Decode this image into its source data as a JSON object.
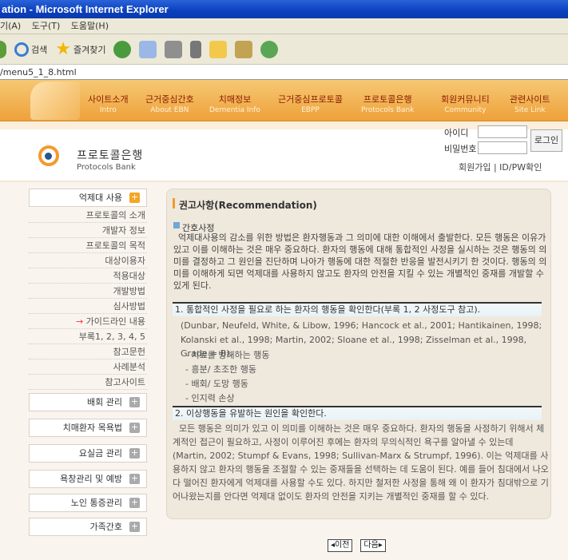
{
  "window": {
    "title": "ation - Microsoft Internet Explorer"
  },
  "menu": [
    "기(A)",
    "도구(T)",
    "도움말(H)"
  ],
  "toolbar": {
    "search": "검색",
    "favorites": "즐겨찾기"
  },
  "address": "/menu5_1_8.html",
  "nav": [
    {
      "ko": "사이트소개",
      "en": "Intro"
    },
    {
      "ko": "근거중심간호",
      "en": "About EBN"
    },
    {
      "ko": "치매정보",
      "en": "Dementia Info"
    },
    {
      "ko": "근거중심프로토콜",
      "en": "EBPP"
    },
    {
      "ko": "프로토콜은행",
      "en": "Protocols Bank"
    },
    {
      "ko": "회원커뮤니티",
      "en": "Community"
    },
    {
      "ko": "관련사이트",
      "en": "Site Link"
    }
  ],
  "site": {
    "title": "프로토콜은행",
    "subtitle": "Protocols Bank"
  },
  "login": {
    "id_label": "아이디",
    "pw_label": "비밀번호",
    "button": "로그인",
    "links": "회원가입 | ID/PW확인"
  },
  "left_menu": {
    "groups": [
      "억제대 사용",
      "배회 관리",
      "치매환자 목욕법",
      "요실금 관리",
      "욕창관리 및 예방",
      "노인 통증관리",
      "가족간호"
    ],
    "sub": [
      "프로토콜의 소개",
      "개발자 정보",
      "프로토콜의 목적",
      "대상이용자",
      "적용대상",
      "개발방법",
      "심사방법",
      "가이드라인 내용",
      "부록1, 2, 3, 4, 5",
      "참고문헌",
      "사례분석",
      "참고사이트"
    ],
    "current_arrow": "→"
  },
  "content": {
    "title": "권고사항(Recommendation)",
    "nurse_head": "간호사정",
    "nurse_text": "억제대사용의 감소를 위한 방법은 환자행동과 그 의미에 대한 이해에서 출발한다. 모든 행동은 이유가 있고 이를 이해하는 것은 매우 중요하다. 환자의 행동에 대해 통합적인 사정을 실시하는 것은 행동의 의미를 결정하고 그 원인을 진단하며 나아가 행동에 대한 적절한 반응을 발전시키기 한 것이다. 행동의 의미를 이해하게 되면 억제대를 사용하지 않고도 환자의 안전을 지킬 수 있는 개별적인 중재를 개발할 수 있게 된다.",
    "step1": "1. 통합적인 사정을 필요로 하는 환자의 행동을 확인한다(부록 1, 2 사정도구 참고).",
    "ref1": "(Dunbar, Neufeld, White, & Libow, 1996; Hancock et al., 2001; Hantikainen, 1998;",
    "ref2": "Kolanski et al., 1998; Martin, 2002; Sloane et al., 1998; Zisselman et al., 1998, Grade = B).",
    "bullets": [
      "- 치료를 방해하는 행동",
      "- 흥분/ 초조한 행동",
      "- 배회/ 도망 행동",
      "- 인지력 손상"
    ],
    "step2": "2. 이상행동을 유발하는 원인을 확인한다.",
    "step2_text": "모든 행동은 의미가 있고 이 의미를 이해하는 것은 매우 중요하다. 환자의 행동을 사정하기 위해서 체계적인 접근이 필요하고, 사정이 이루어진 후에는 환자의 무의식적인 욕구를 알아낼 수 있는데 (Martin, 2002; Stumpf & Evans, 1998; Sullivan-Marx & Strumpf, 1996). 이는 억제대를 사용하지 않고 환자의 행동을 조절할 수 있는 중재들을 선택하는 데 도움이 된다. 예를 들어 침대에서 나오다 떨어진 환자에게 억제대를 사용할 수도 있다. 하지만 철저한 사정을 통해 왜 이 환자가 침대밖으로 기어나왔는지를 안다면 억제대 없이도 환자의 안전을 지키는 개별적인 중재를 할 수 있다."
  },
  "pager": {
    "prev": "◂이전",
    "next": "다음▸"
  }
}
